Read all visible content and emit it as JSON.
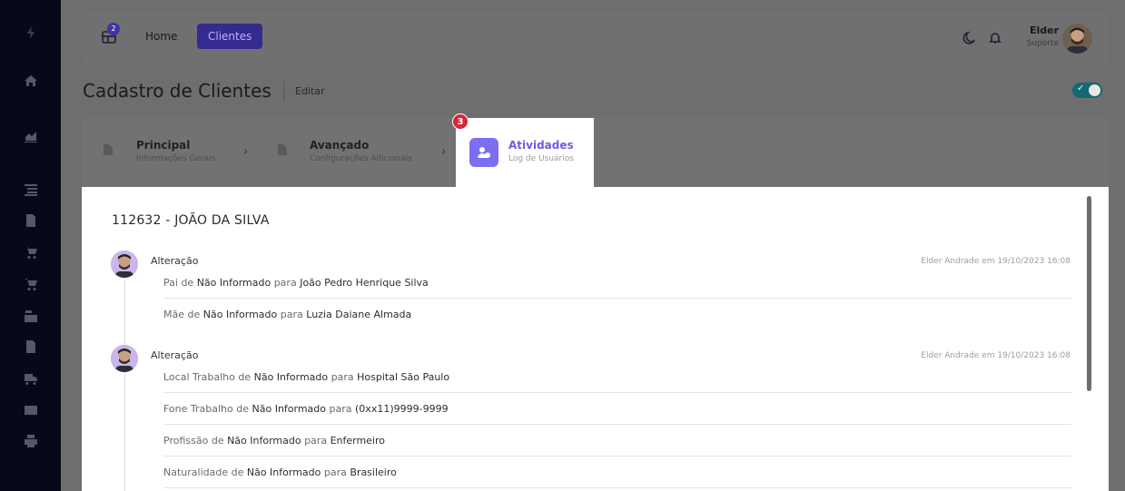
{
  "topbar": {
    "grid_badge": "2",
    "nav": [
      "Home",
      "Clientes"
    ],
    "user_name": "Elder",
    "user_role": "Suporte"
  },
  "page": {
    "title": "Cadastro de Clientes",
    "edit": "Editar"
  },
  "steps": [
    {
      "title": "Principal",
      "subtitle": "Informações Gerais"
    },
    {
      "title": "Avançado",
      "subtitle": "Configurações Adicionais"
    },
    {
      "title": "Atividades",
      "subtitle": "Log de Usuários",
      "badge": "3"
    }
  ],
  "client": {
    "title": "112632 - JOÃO DA SILVA"
  },
  "activities": [
    {
      "title": "Alteração",
      "meta": "Elder Andrade em 19/10/2023 16:08",
      "changes": [
        {
          "field": "Pai",
          "from": "Não Informado",
          "to": "João Pedro Henrique Silva"
        },
        {
          "field": "Mãe",
          "from": "Não Informado",
          "to": "Luzia Daiane Almada"
        }
      ]
    },
    {
      "title": "Alteração",
      "meta": "Elder Andrade em 19/10/2023 16:08",
      "changes": [
        {
          "field": "Local Trabalho",
          "from": "Não Informado",
          "to": "Hospital São Paulo"
        },
        {
          "field": "Fone Trabalho",
          "from": "Não Informado",
          "to": "(0xx11)9999-9999"
        },
        {
          "field": "Profissão",
          "from": "Não Informado",
          "to": "Enfermeiro"
        },
        {
          "field": "Naturalidade",
          "from": "Não Informado",
          "to": "Brasileiro"
        }
      ]
    }
  ],
  "words": {
    "de": "de",
    "para": "para"
  },
  "colors": {
    "accent": "#6c5ce7",
    "sidebar": "#07091a",
    "badge": "#d72638",
    "toggle": "#136a72"
  }
}
